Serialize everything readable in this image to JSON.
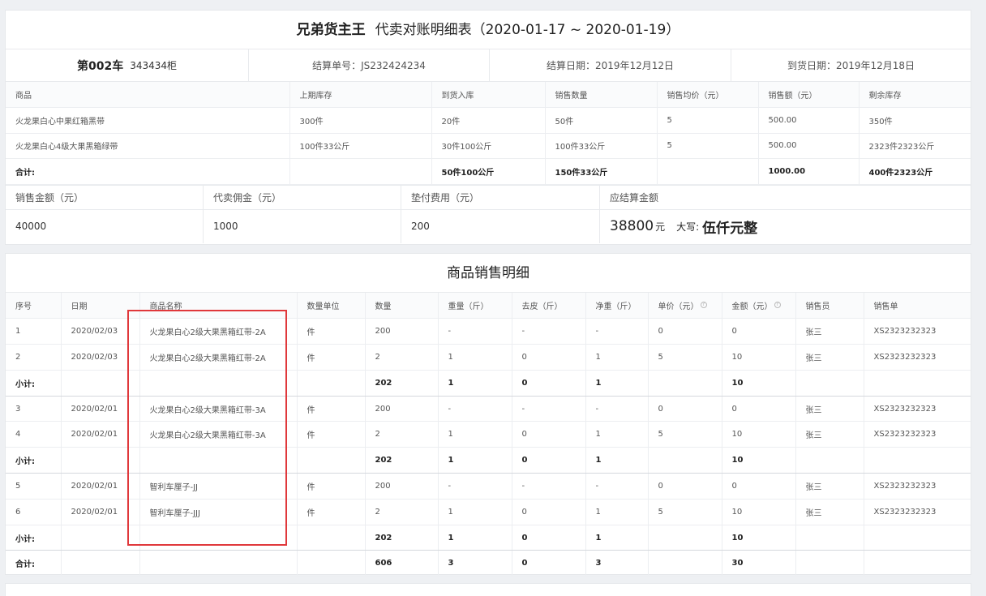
{
  "header": {
    "brand": "兄弟货主王",
    "title": "代卖对账明细表（2020-01-17 ~ 2020-01-19）"
  },
  "info": {
    "car_no": "第002车",
    "cabinet": "343434柜",
    "settle_no": "结算单号：JS232424234",
    "settle_date": "结算日期：2019年12月12日",
    "arrival_date": "到货日期：2019年12月18日"
  },
  "goods": {
    "headers": [
      "商品",
      "上期库存",
      "到货入库",
      "销售数量",
      "销售均价（元）",
      "销售额（元）",
      "剩余库存"
    ],
    "rows": [
      [
        "火龙果白心中果红箱黑带",
        "300件",
        "20件",
        "50件",
        "5",
        "500.00",
        "350件"
      ],
      [
        "火龙果白心4级大果黑箱绿带",
        "100件33公斤",
        "30件100公斤",
        "100件33公斤",
        "5",
        "500.00",
        "2323件2323公斤"
      ]
    ],
    "total": [
      "合计:",
      "",
      "50件100公斤",
      "150件33公斤",
      "",
      "1000.00",
      "400件2323公斤"
    ]
  },
  "settlement": {
    "sales_label": "销售金额（元）",
    "sales_value": "40000",
    "commission_label": "代卖佣金（元）",
    "commission_value": "1000",
    "advance_label": "垫付费用（元）",
    "advance_value": "200",
    "payable_label": "应结算金额",
    "payable_value": "38800",
    "payable_unit": "元",
    "daxie_label": "大写:",
    "daxie_value": "伍仟元整"
  },
  "detail": {
    "title": "商品销售明细",
    "headers": [
      "序号",
      "日期",
      "商品名称",
      "数量单位",
      "数量",
      "重量（斤）",
      "去皮（斤）",
      "净重（斤）",
      "单价（元）",
      "金额（元）",
      "销售员",
      "销售单"
    ],
    "rows": [
      {
        "type": "row",
        "cells": [
          "1",
          "2020/02/03",
          "火龙果白心2级大果黑箱红带-2A",
          "件",
          "200",
          "-",
          "-",
          "-",
          "0",
          "0",
          "张三",
          "XS2323232323"
        ]
      },
      {
        "type": "row",
        "cells": [
          "2",
          "2020/02/03",
          "火龙果白心2级大果黑箱红带-2A",
          "件",
          "2",
          "1",
          "0",
          "1",
          "5",
          "10",
          "张三",
          "XS2323232323"
        ]
      },
      {
        "type": "subtotal",
        "cells": [
          "小计:",
          "",
          "",
          "",
          "202",
          "1",
          "0",
          "1",
          "",
          "10",
          "",
          ""
        ]
      },
      {
        "type": "row",
        "cells": [
          "3",
          "2020/02/01",
          "火龙果白心2级大果黑箱红带-3A",
          "件",
          "200",
          "-",
          "-",
          "-",
          "0",
          "0",
          "张三",
          "XS2323232323"
        ]
      },
      {
        "type": "row",
        "cells": [
          "4",
          "2020/02/01",
          "火龙果白心2级大果黑箱红带-3A",
          "件",
          "2",
          "1",
          "0",
          "1",
          "5",
          "10",
          "张三",
          "XS2323232323"
        ]
      },
      {
        "type": "subtotal",
        "cells": [
          "小计:",
          "",
          "",
          "",
          "202",
          "1",
          "0",
          "1",
          "",
          "10",
          "",
          ""
        ]
      },
      {
        "type": "row",
        "cells": [
          "5",
          "2020/02/01",
          "智利车厘子-JJ",
          "件",
          "200",
          "-",
          "-",
          "-",
          "0",
          "0",
          "张三",
          "XS2323232323"
        ]
      },
      {
        "type": "row",
        "cells": [
          "6",
          "2020/02/01",
          "智利车厘子-JJJ",
          "件",
          "2",
          "1",
          "0",
          "1",
          "5",
          "10",
          "张三",
          "XS2323232323"
        ]
      },
      {
        "type": "subtotal",
        "cells": [
          "小计:",
          "",
          "",
          "",
          "202",
          "1",
          "0",
          "1",
          "",
          "10",
          "",
          ""
        ]
      },
      {
        "type": "total",
        "cells": [
          "合计:",
          "",
          "",
          "",
          "606",
          "3",
          "0",
          "3",
          "",
          "30",
          "",
          ""
        ]
      }
    ]
  },
  "colors": {
    "highlight_box": "#e0383b",
    "background": "#eef0f3"
  }
}
